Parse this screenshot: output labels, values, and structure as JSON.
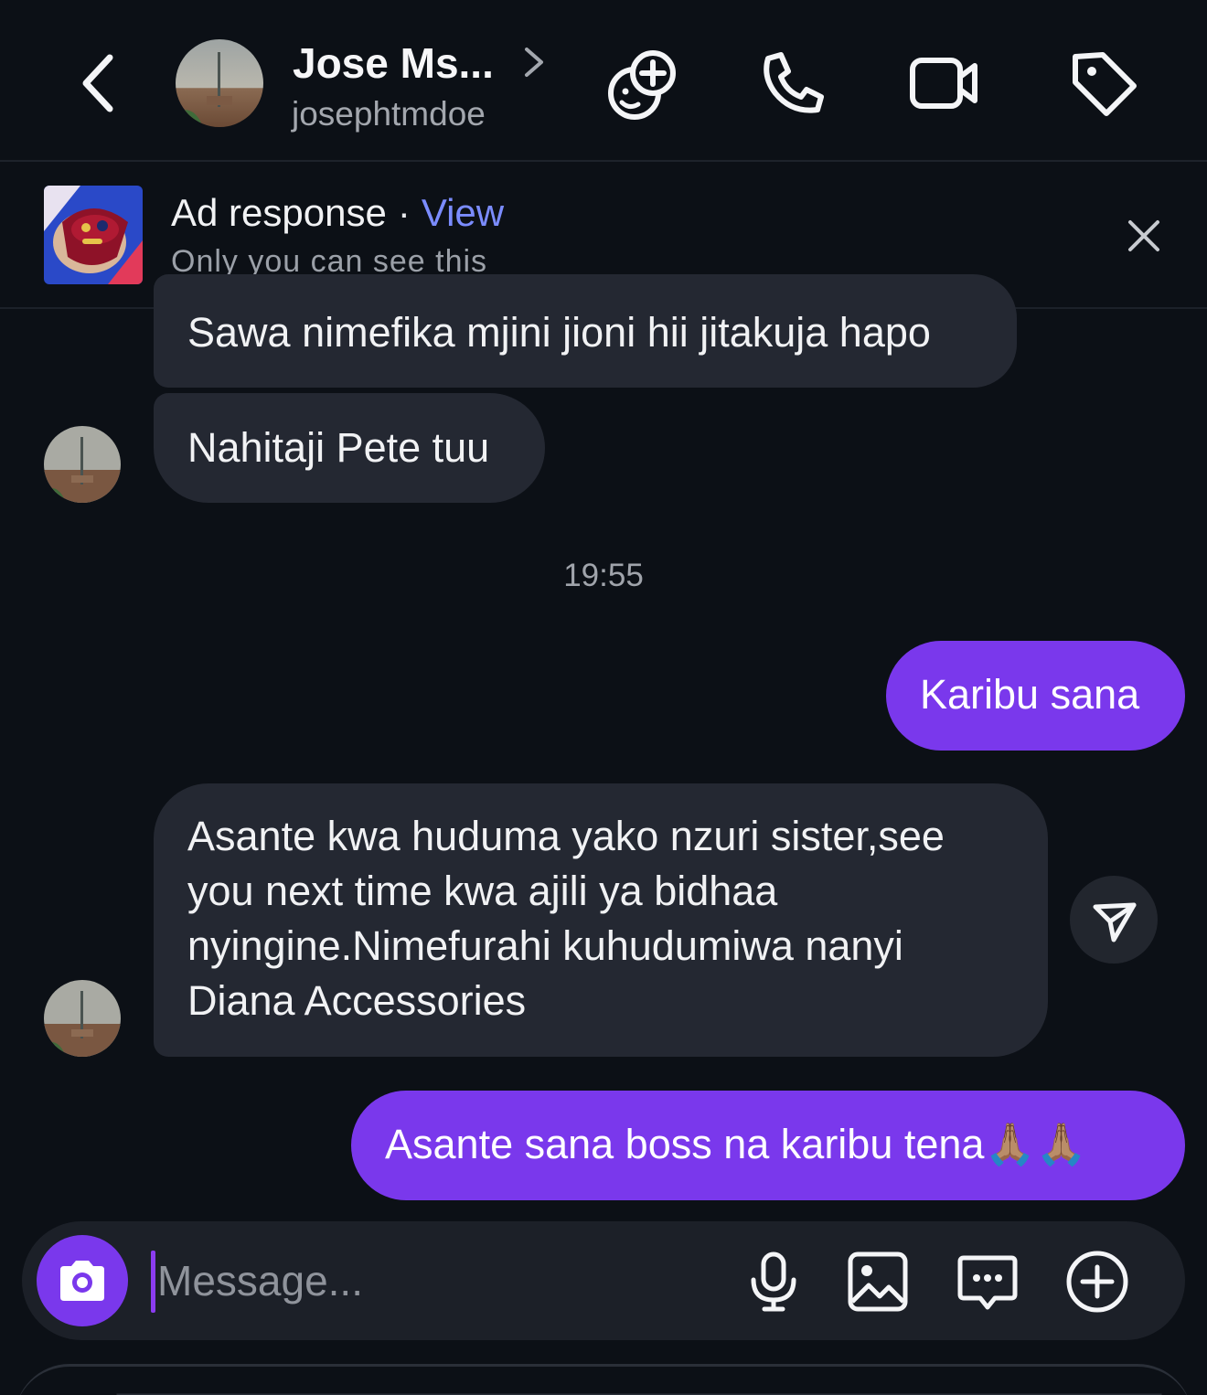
{
  "header": {
    "contact_name": "Jose Ms...",
    "contact_handle": "josephtmdoe",
    "icons": [
      "back-chevron-icon",
      "effects-add-icon",
      "phone-icon",
      "video-camera-icon",
      "tag-icon"
    ]
  },
  "ad_banner": {
    "title": "Ad response",
    "separator": "·",
    "view_link": "View",
    "subtitle": "Only you can see this"
  },
  "conversation": {
    "messages": [
      {
        "direction": "in",
        "text": "Sawa nimefika mjini jioni hii jitakuja hapo"
      },
      {
        "direction": "in",
        "text": "Nahitaji Pete tuu"
      },
      {
        "direction": "out",
        "text": "Karibu sana"
      },
      {
        "direction": "in",
        "lines": [
          "Asante kwa huduma yako nzuri sister,see",
          "you next time kwa ajili ya bidhaa",
          "nyingine.Nimefurahi kuhudumiwa nanyi",
          "Diana Accessories"
        ]
      },
      {
        "direction": "out",
        "text": "Asante sana boss na karibu tena🙏🏽🙏🏽"
      }
    ],
    "timestamp": "19:55"
  },
  "composer": {
    "placeholder": "Message...",
    "icons": [
      "camera-icon",
      "microphone-icon",
      "gallery-icon",
      "sticker-chat-icon",
      "plus-circle-icon"
    ]
  },
  "colors": {
    "background": "#0c1016",
    "incoming_bubble": "#242832",
    "outgoing_bubble": "#7a38ec",
    "link": "#7b8cff"
  }
}
